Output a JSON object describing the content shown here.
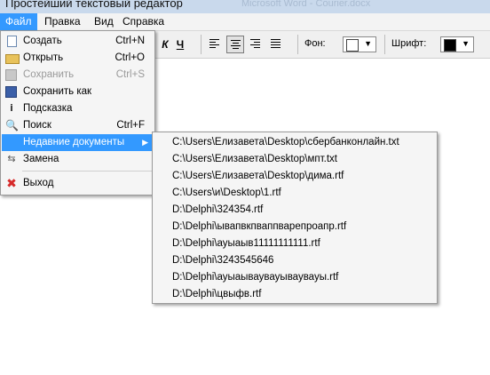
{
  "window": {
    "title": "Простейший текстовый редактор",
    "background_caption": "Microsoft Word - Courier.docx"
  },
  "menubar": [
    {
      "label": "Файл",
      "active": true
    },
    {
      "label": "Правка"
    },
    {
      "label": "Вид"
    },
    {
      "label": "Справка"
    }
  ],
  "toolbar": {
    "italic_glyph": "К",
    "underline_glyph": "Ч",
    "background_label": "Фон:",
    "font_label": "Шрифт:",
    "background_color": "#ffffff",
    "font_color": "#000000"
  },
  "file_menu": [
    {
      "icon": "new-document-icon",
      "label": "Создать",
      "shortcut": "Ctrl+N"
    },
    {
      "icon": "open-folder-icon",
      "label": "Открыть",
      "shortcut": "Ctrl+O"
    },
    {
      "icon": "save-disk-icon",
      "label": "Сохранить",
      "shortcut": "Ctrl+S",
      "disabled": true
    },
    {
      "icon": "save-as-icon",
      "label": "Сохранить как",
      "shortcut": ""
    },
    {
      "icon": "hint-icon",
      "label": "Подсказка",
      "shortcut": ""
    },
    {
      "icon": "search-magnifier-icon",
      "label": "Поиск",
      "shortcut": "Ctrl+F"
    },
    {
      "icon": "",
      "label": "Недавние документы",
      "shortcut": "",
      "highlighted": true,
      "submenu": true
    },
    {
      "icon": "replace-icon",
      "label": "Замена",
      "shortcut": ""
    },
    {
      "icon": "exit-x-icon",
      "label": "Выход",
      "shortcut": ""
    }
  ],
  "recent_documents": [
    "C:\\Users\\Елизавета\\Desktop\\сбербанконлайн.txt",
    "C:\\Users\\Елизавета\\Desktop\\мпт.txt",
    "C:\\Users\\Елизавета\\Desktop\\дима.rtf",
    "C:\\Users\\и\\Desktop\\1.rtf",
    "D:\\Delphi\\324354.rtf",
    "D:\\Delphi\\ывапвкпваппварепроапр.rtf",
    "D:\\Delphi\\ауыаыв11111111111.rtf",
    "D:\\Delphi\\3243545646",
    "D:\\Delphi\\ауыаываувауываувауы.rtf",
    "D:\\Delphi\\цвыфв.rtf"
  ],
  "colors": {
    "highlight": "#3399ff",
    "menu_background": "#f5f5f5",
    "titlebar": "#c9d9ec"
  }
}
